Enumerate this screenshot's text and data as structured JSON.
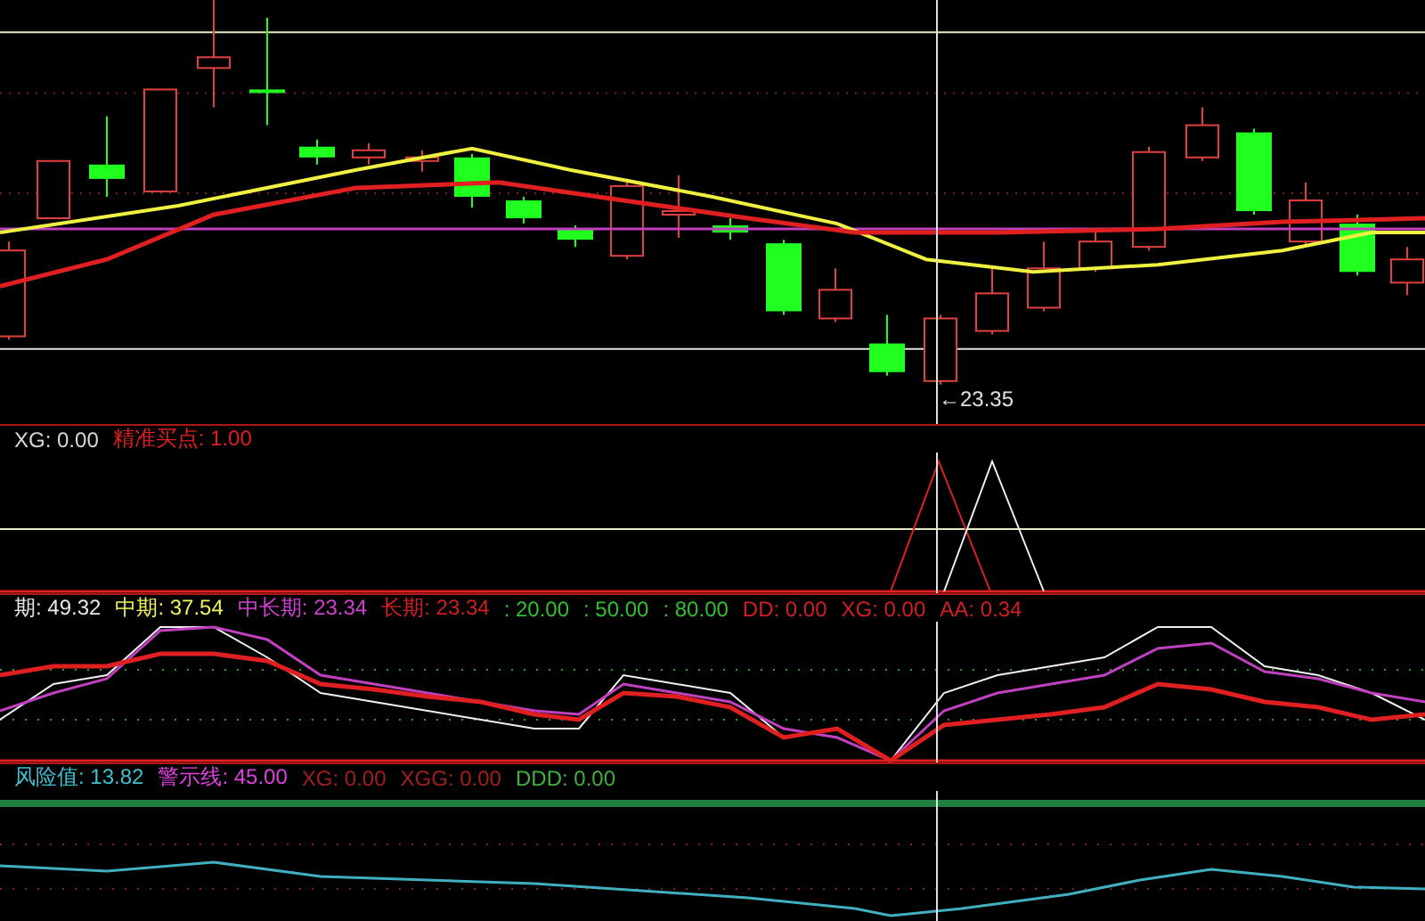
{
  "main_pane": {
    "price_label": "←23.35"
  },
  "signal_pane": {
    "legend": [
      {
        "text": "XG: 0.00",
        "color": "#d8d8d8"
      },
      {
        "text": "精准买点: 1.00",
        "color": "#e02020"
      }
    ]
  },
  "trend_pane": {
    "legend": [
      {
        "text": "期: 49.32",
        "color": "#e8e8e8"
      },
      {
        "text": "中期: 37.54",
        "color": "#f0f060"
      },
      {
        "text": "中长期: 23.34",
        "color": "#d040d0"
      },
      {
        "text": "长期: 23.34",
        "color": "#d02020"
      },
      {
        "text": ": 20.00",
        "color": "#30c030"
      },
      {
        "text": ": 50.00",
        "color": "#30c030"
      },
      {
        "text": ": 80.00",
        "color": "#30c030"
      },
      {
        "text": "DD: 0.00",
        "color": "#d02020"
      },
      {
        "text": "XG: 0.00",
        "color": "#d02020"
      },
      {
        "text": "AA: 0.34",
        "color": "#d02020"
      }
    ]
  },
  "risk_pane": {
    "legend": [
      {
        "text": "风险值: 13.82",
        "color": "#40c0d0"
      },
      {
        "text": "警示线: 45.00",
        "color": "#e040e0"
      },
      {
        "text": "XG: 0.00",
        "color": "#a02020"
      },
      {
        "text": "XGG: 0.00",
        "color": "#a02020"
      },
      {
        "text": "DDD: 0.00",
        "color": "#40b040"
      }
    ]
  }
}
